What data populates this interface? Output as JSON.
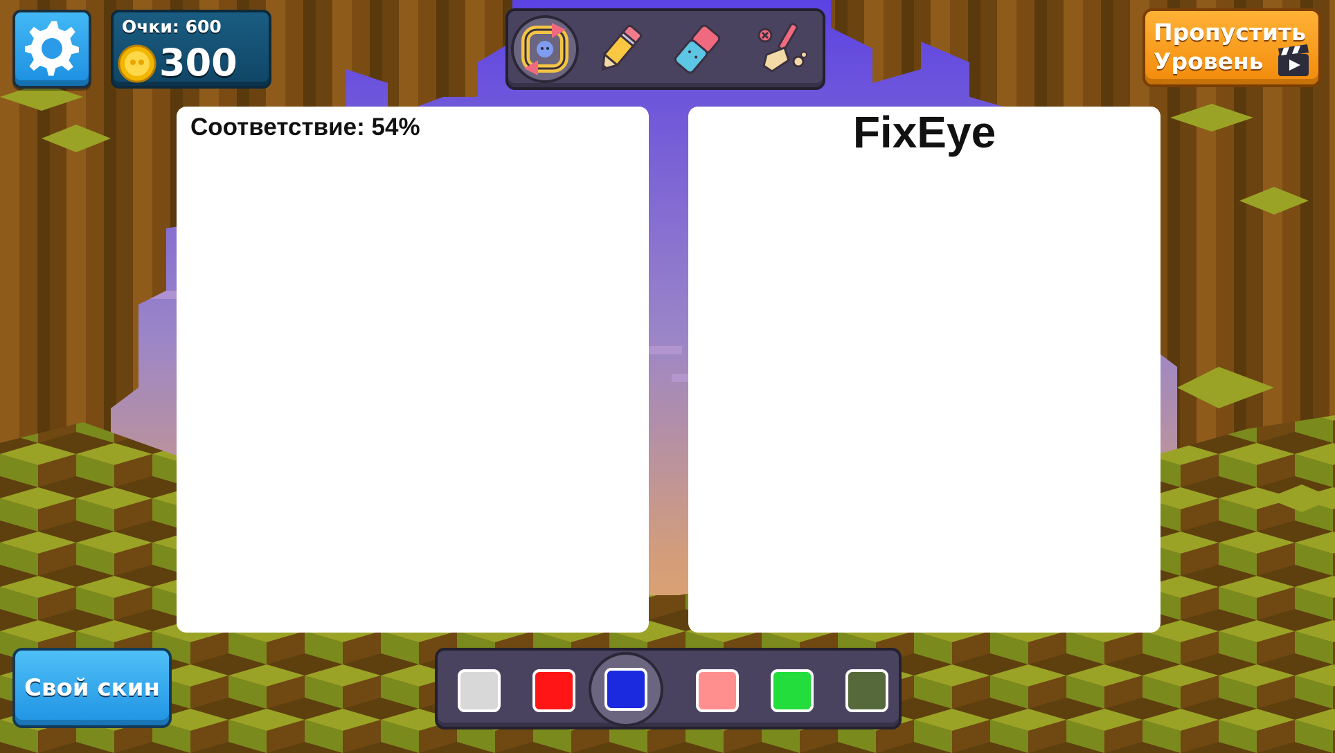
{
  "hud": {
    "score_label": "Очки: 600",
    "coins": "300",
    "skip_level_label": "Пропустить Уровень",
    "custom_skin_label": "Свой скин"
  },
  "toolbar": {
    "tools": [
      {
        "icon": "rotate-icon",
        "selected": true
      },
      {
        "icon": "pencil-icon",
        "selected": false
      },
      {
        "icon": "eraser-icon",
        "selected": false
      },
      {
        "icon": "clear-broom-icon",
        "selected": false
      }
    ]
  },
  "boards": {
    "match_text": "Соответствие: 54%",
    "target_title": "FixEye"
  },
  "palette": {
    "selected_index": 2,
    "colors": [
      "#d8d8d8",
      "#ff1515",
      "#1c2adf",
      "#ff8f8f",
      "#22dd3b",
      "#56693a"
    ]
  }
}
